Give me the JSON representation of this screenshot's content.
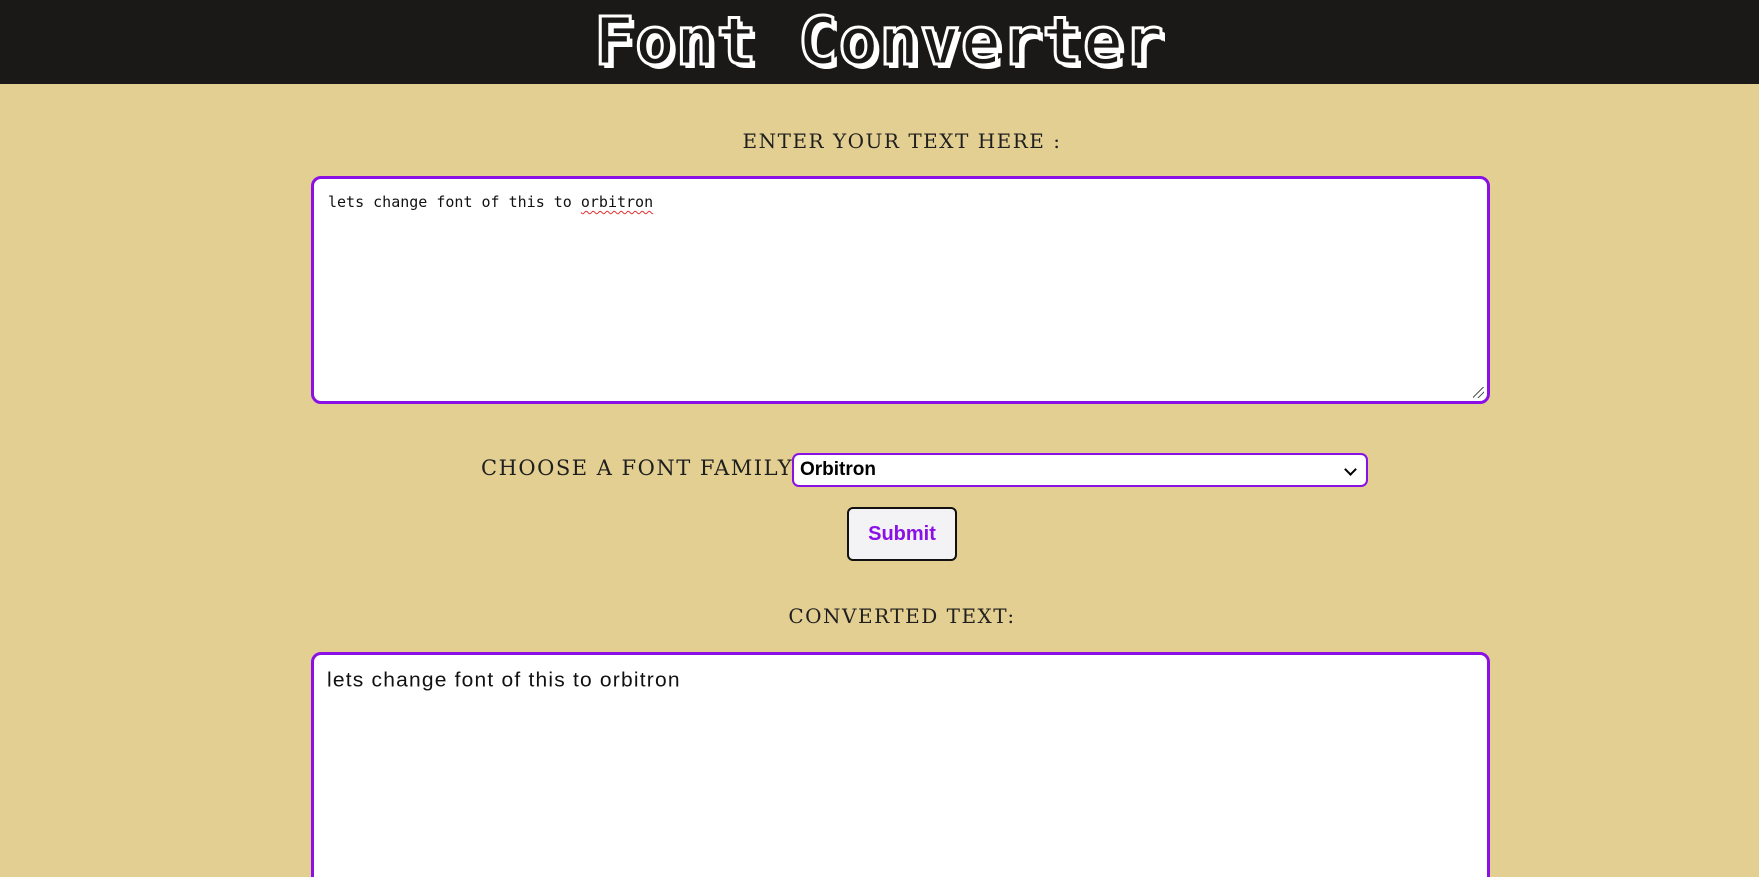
{
  "header": {
    "title": "Font Converter"
  },
  "input": {
    "label": "Enter your text here :",
    "value_prefix": "lets change font of this to ",
    "value_misspelled": "orbitron"
  },
  "font_select": {
    "label": "Choose a font family:",
    "selected": "Orbitron"
  },
  "submit": {
    "label": "Submit"
  },
  "output": {
    "label": "Converted text:",
    "value": "lets change font of this to orbitron"
  },
  "colors": {
    "background": "#e3cf91",
    "header": "#1b1818",
    "accent": "#8a10e6"
  }
}
